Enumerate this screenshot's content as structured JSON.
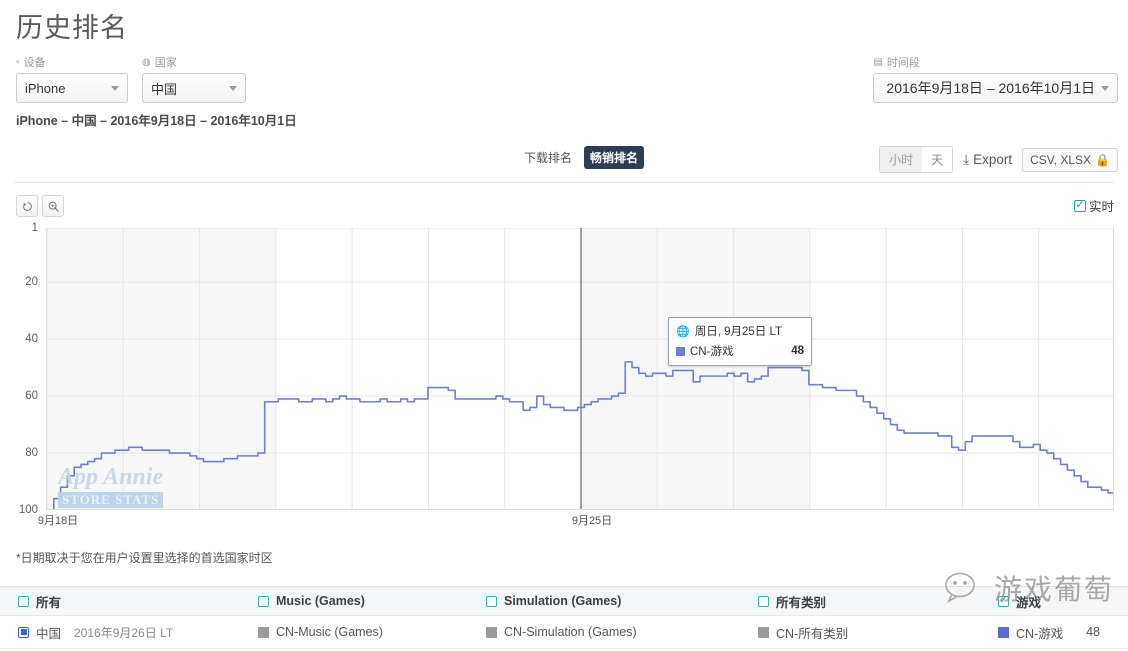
{
  "header": {
    "title": "历史排名",
    "device_label": "设备",
    "device_value": "iPhone",
    "country_label": "国家",
    "country_value": "中国",
    "daterange_label": "时间段",
    "daterange_value": "2016年9月18日 – 2016年10月1日",
    "subtitle": "iPhone – 中国 – 2016年9月18日 – 2016年10月1日"
  },
  "toolbar": {
    "tab_free": "下载排名",
    "tab_grossing": "畅销排名",
    "seg_hour": "小时",
    "seg_day": "天",
    "export_label": "Export",
    "export_format": "CSV, XLSX",
    "lock_icon": "lock-icon",
    "download_icon": "download-icon"
  },
  "chart_controls": {
    "reset_icon": "reset-icon",
    "zoom_icon": "magnifier-icon",
    "realtime_label": "实时",
    "realtime_checked": true
  },
  "tooltip": {
    "date": "周日, 9月25日 LT",
    "series": "CN-游戏",
    "value": "48",
    "globe_icon": "globe-icon"
  },
  "footnote": "*日期取决于您在用户设置里选择的首选国家时区",
  "watermarks": {
    "app_annie": "App Annie",
    "app_annie_sub": "STORE STATS",
    "wechat": "游戏葡萄"
  },
  "legend": {
    "headers": [
      {
        "label": "所有",
        "checked": false
      },
      {
        "label": "Music (Games)",
        "checked": false
      },
      {
        "label": "Simulation (Games)",
        "checked": false
      },
      {
        "label": "所有类别",
        "checked": false
      },
      {
        "label": "游戏",
        "checked": true
      }
    ],
    "row": {
      "country": "中国",
      "timestamp": "2016年9月26日 LT",
      "items": [
        {
          "label": "CN-Music (Games)",
          "color": "#9b9b9b",
          "value": ""
        },
        {
          "label": "CN-Simulation (Games)",
          "color": "#9b9b9b",
          "value": ""
        },
        {
          "label": "CN-所有类别",
          "color": "#9b9b9b",
          "value": ""
        },
        {
          "label": "CN-游戏",
          "color": "#5c6bd4",
          "value": "48"
        }
      ]
    }
  },
  "chart_data": {
    "type": "line",
    "title": "",
    "xlabel": "",
    "ylabel": "",
    "series_name": "CN-游戏",
    "series_color": "#6f7fd0",
    "ylim": [
      1,
      100
    ],
    "y_inverted": true,
    "yticks": [
      1,
      20,
      40,
      60,
      80,
      100
    ],
    "xticks": [
      "9月18日",
      "9月25日"
    ],
    "x_range": [
      "2016-09-18",
      "2016-10-01"
    ],
    "grid": true,
    "weekend_bands": [
      [
        0,
        2
      ],
      [
        7,
        9
      ],
      [
        14,
        14
      ]
    ],
    "highlight_x_index": 7,
    "highlight_value": 48,
    "n_points": 112,
    "values": [
      100,
      96,
      92,
      88,
      85,
      84,
      83,
      82,
      80,
      80,
      79,
      79,
      78,
      78,
      79,
      79,
      79,
      79,
      80,
      80,
      80,
      81,
      82,
      83,
      83,
      83,
      82,
      82,
      81,
      81,
      81,
      80,
      62,
      62,
      61,
      61,
      61,
      62,
      62,
      61,
      61,
      62,
      61,
      60,
      61,
      61,
      62,
      62,
      62,
      61,
      62,
      62,
      61,
      62,
      61,
      61,
      57,
      57,
      57,
      58,
      61,
      61,
      61,
      61,
      61,
      61,
      60,
      61,
      62,
      62,
      65,
      64,
      60,
      63,
      64,
      64,
      65,
      65,
      64,
      63,
      62,
      61,
      61,
      60,
      59,
      48,
      50,
      52,
      53,
      52,
      52,
      53,
      51,
      51,
      51,
      55,
      53,
      53,
      53,
      53,
      52,
      53,
      52,
      55,
      54,
      53,
      50,
      50,
      50,
      50,
      50,
      51
    ],
    "tail_values": [
      56,
      56,
      57,
      57,
      58,
      58,
      58,
      60,
      62,
      64,
      66,
      68,
      70,
      72,
      73,
      73,
      73,
      73,
      73,
      74,
      74,
      78,
      79,
      76,
      74,
      74,
      74,
      74,
      74,
      74,
      76,
      78,
      78,
      77,
      79,
      80,
      82,
      84,
      86,
      88,
      90,
      92,
      92,
      93,
      94,
      96
    ]
  }
}
